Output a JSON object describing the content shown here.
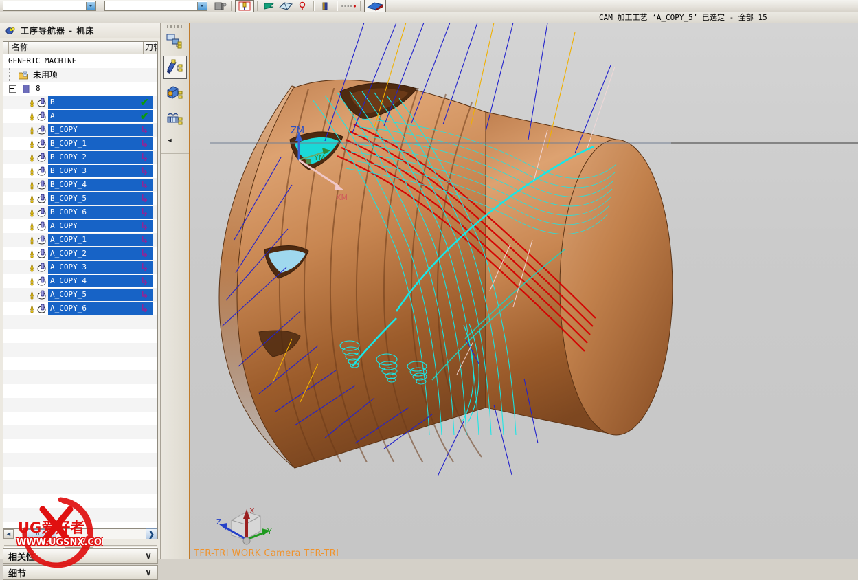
{
  "window": {
    "cue_text": "CAM 加工工艺 ‘A_COPY_5’ 已选定 - 全部 15"
  },
  "toolbar": {
    "combo1_value": "",
    "combo2_value": "",
    "icons": [
      {
        "name": "shaded-toggle-icon",
        "label": "Shaded"
      },
      {
        "name": "tool-holder-icon",
        "label": "刀具"
      },
      {
        "name": "green-flag-icon",
        "label": "标记"
      },
      {
        "name": "face-selection-icon",
        "label": "面"
      },
      {
        "name": "point-set-icon",
        "label": "点"
      },
      {
        "name": "layer-settings-icon",
        "label": "图层设置"
      },
      {
        "name": "dashed-line-icon",
        "label": "虚线"
      },
      {
        "name": "shaded-view-icon",
        "label": "着色视图"
      }
    ]
  },
  "navigator": {
    "title": "工序导航器 - 机床",
    "title_icon": "operation-navigator-icon",
    "columns": [
      "",
      "名称",
      "刀轨"
    ],
    "rows": [
      {
        "label": "GENERIC_MACHINE",
        "indent": 0,
        "type": "root",
        "icon": "",
        "selected": false,
        "status": ""
      },
      {
        "label": "未用项",
        "indent": 1,
        "type": "folder",
        "icon": "folder-icon",
        "selected": false,
        "status": ""
      },
      {
        "label": "8",
        "indent": 1,
        "type": "machine",
        "icon": "machine-icon",
        "selected": false,
        "status": "",
        "expander": true
      },
      {
        "label": "B",
        "indent": 2,
        "type": "op",
        "icon": "tool-b-icon",
        "selected": true,
        "status": "check"
      },
      {
        "label": "A",
        "indent": 2,
        "type": "op",
        "icon": "tool-a-icon",
        "selected": true,
        "status": "check"
      },
      {
        "label": "B_COPY",
        "indent": 2,
        "type": "op",
        "icon": "tool-b-icon",
        "selected": true,
        "status": "regen"
      },
      {
        "label": "B_COPY_1",
        "indent": 2,
        "type": "op",
        "icon": "tool-b-icon",
        "selected": true,
        "status": "regen"
      },
      {
        "label": "B_COPY_2",
        "indent": 2,
        "type": "op",
        "icon": "tool-b-icon",
        "selected": true,
        "status": "regen"
      },
      {
        "label": "B_COPY_3",
        "indent": 2,
        "type": "op",
        "icon": "tool-b-icon",
        "selected": true,
        "status": "regen"
      },
      {
        "label": "B_COPY_4",
        "indent": 2,
        "type": "op",
        "icon": "tool-b-icon",
        "selected": true,
        "status": "regen"
      },
      {
        "label": "B_COPY_5",
        "indent": 2,
        "type": "op",
        "icon": "tool-b-icon",
        "selected": true,
        "status": "regen"
      },
      {
        "label": "B_COPY_6",
        "indent": 2,
        "type": "op",
        "icon": "tool-b-icon",
        "selected": true,
        "status": "regen"
      },
      {
        "label": "A_COPY",
        "indent": 2,
        "type": "op",
        "icon": "tool-a-icon",
        "selected": true,
        "status": "regen"
      },
      {
        "label": "A_COPY_1",
        "indent": 2,
        "type": "op",
        "icon": "tool-a-icon",
        "selected": true,
        "status": "regen"
      },
      {
        "label": "A_COPY_2",
        "indent": 2,
        "type": "op",
        "icon": "tool-a-icon",
        "selected": true,
        "status": "regen"
      },
      {
        "label": "A_COPY_3",
        "indent": 2,
        "type": "op",
        "icon": "tool-a-icon",
        "selected": true,
        "status": "regen"
      },
      {
        "label": "A_COPY_4",
        "indent": 2,
        "type": "op",
        "icon": "tool-a-icon",
        "selected": true,
        "status": "regen"
      },
      {
        "label": "A_COPY_5",
        "indent": 2,
        "type": "op",
        "icon": "tool-a-icon",
        "selected": true,
        "status": "regen"
      },
      {
        "label": "A_COPY_6",
        "indent": 2,
        "type": "op",
        "icon": "tool-a-icon",
        "selected": true,
        "status": "regen"
      }
    ],
    "hscroll": {
      "left_arrow": "◄",
      "right_arrow": "❯"
    },
    "bottom_panels": [
      {
        "label": "相关性",
        "chevron": "∨"
      },
      {
        "label": "细节",
        "chevron": "∨"
      }
    ]
  },
  "resource_bar": {
    "tabs": [
      {
        "name": "program-order-view-tab",
        "active": false
      },
      {
        "name": "machine-tool-view-tab",
        "active": true
      },
      {
        "name": "geometry-view-tab",
        "active": false
      },
      {
        "name": "machining-method-view-tab",
        "active": false
      }
    ],
    "collapse_glyph": "◄"
  },
  "viewport": {
    "view_label": "TFR-TRI WORK Camera TFR-TRI",
    "mcs_label": "ZM",
    "mcs_axes": [
      {
        "name": "ZM",
        "color": "#3b5fd0"
      },
      {
        "name": "YM",
        "color": "#2e8b3a"
      },
      {
        "name": "XM",
        "color": "#d05b5b"
      }
    ],
    "triad_axes": [
      {
        "name": "X",
        "color": "#b03030"
      },
      {
        "name": "Y",
        "color": "#1f9a1f"
      },
      {
        "name": "Z",
        "color": "#2440c8"
      }
    ],
    "colors": {
      "background_top": "#d4d4d4",
      "background_bottom": "#c6c6c6",
      "part_light": "#d9996a",
      "part_mid": "#b87441",
      "part_dark": "#8a4f24",
      "toolpath_cyan": "#16e8e8",
      "toolpath_red": "#d40000",
      "rapid_blue": "#2222cc",
      "engage_yellow": "#f0b000",
      "retract_pink": "#f0c8c8"
    }
  },
  "watermark": {
    "text_main": "UG爱好者",
    "text_url": "WWW.UGSNX.COM",
    "color": "#e01010"
  }
}
